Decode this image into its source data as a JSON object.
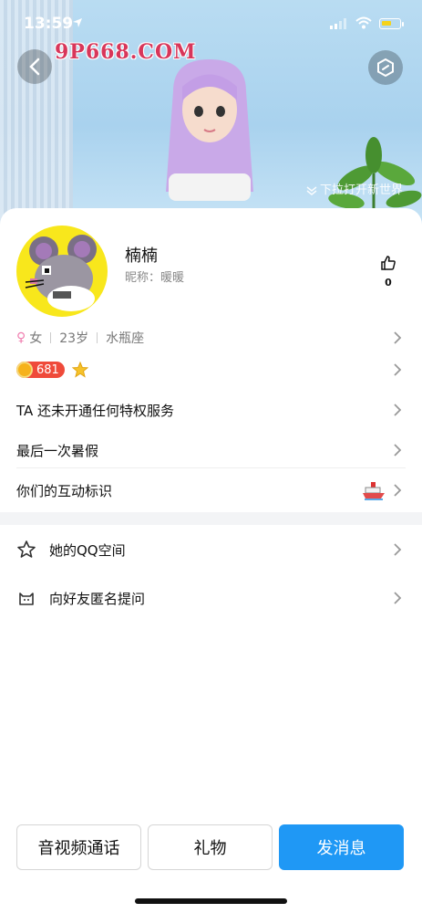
{
  "status_bar": {
    "time": "13:59"
  },
  "watermark": "9P668.COM",
  "header": {
    "pull_hint": "下拉打开新世界"
  },
  "profile": {
    "name": "楠楠",
    "nickname": "昵称：暖暖",
    "likes": "0",
    "tags": [
      "女",
      "23岁",
      "水瓶座"
    ],
    "level_value": "681"
  },
  "menu": {
    "privilege": "TA 还未开通任何特权服务",
    "last_summer": "最后一次暑假",
    "interaction": "你们的互动标识"
  },
  "links": {
    "qzone": "她的QQ空间",
    "anonymous": "向好友匿名提问"
  },
  "actions": {
    "video_call": "音视频通话",
    "gift": "礼物",
    "message": "发消息"
  },
  "colors": {
    "primary": "#1f98f5",
    "avatar_bg": "#f8e71c",
    "coin_badge": "#ef4a3a"
  }
}
